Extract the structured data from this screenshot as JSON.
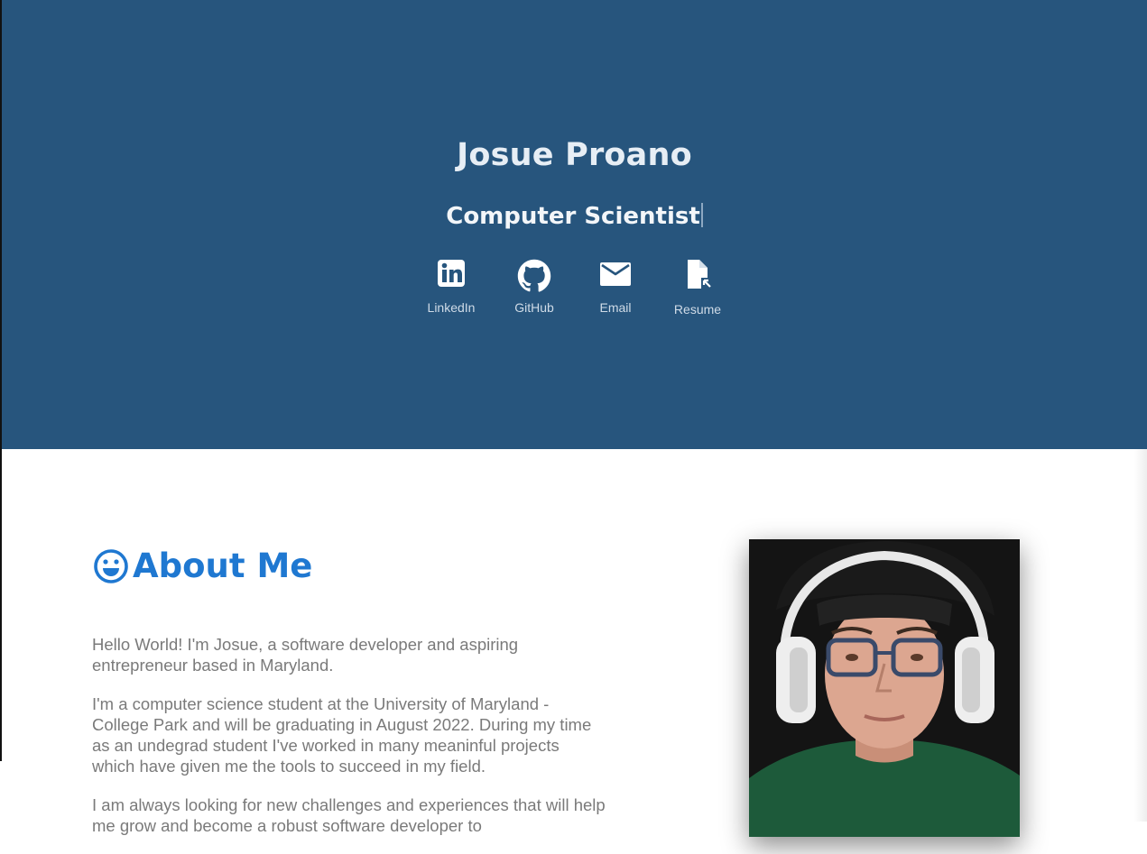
{
  "hero": {
    "name": "Josue Proano",
    "role": "Computer Scientist",
    "links": [
      {
        "label": "LinkedIn",
        "icon": "linkedin-icon"
      },
      {
        "label": "GitHub",
        "icon": "github-icon"
      },
      {
        "label": "Email",
        "icon": "email-icon"
      },
      {
        "label": "Resume",
        "icon": "resume-file-icon"
      }
    ],
    "background_color": "#27557d"
  },
  "about": {
    "title": "About Me",
    "title_icon": "smiley-icon",
    "title_color": "#1f78d1",
    "paragraphs": [
      "Hello World! I'm Josue, a software developer and aspiring entrepreneur based in Maryland.",
      "I'm a computer science student at the University of Maryland - College Park and will be graduating in August 2022. During my time as an undegrad student I've worked in many meaninful projects which have given me the tools to succeed in my field.",
      "I am always looking for new challenges and experiences that will help me grow and become a robust software developer to"
    ],
    "photo": "profile-photo"
  }
}
